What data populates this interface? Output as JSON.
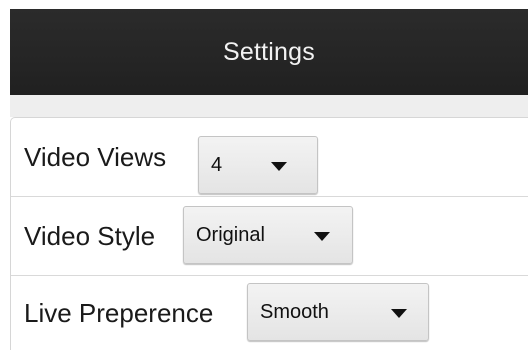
{
  "header": {
    "title": "Settings"
  },
  "settings": [
    {
      "label": "Video Views",
      "value": "4",
      "icon": "caret-down-icon"
    },
    {
      "label": "Video Style",
      "value": "Original",
      "icon": "caret-down-icon"
    },
    {
      "label": "Live Preperence",
      "value": "Smooth",
      "icon": "caret-down-icon"
    }
  ],
  "colors": {
    "header_bg": "#252525",
    "header_text": "#f2f2f2",
    "list_bg": "#ffffff",
    "divider": "#d9d9d9",
    "dropdown_bg": "#e9e9e9"
  }
}
